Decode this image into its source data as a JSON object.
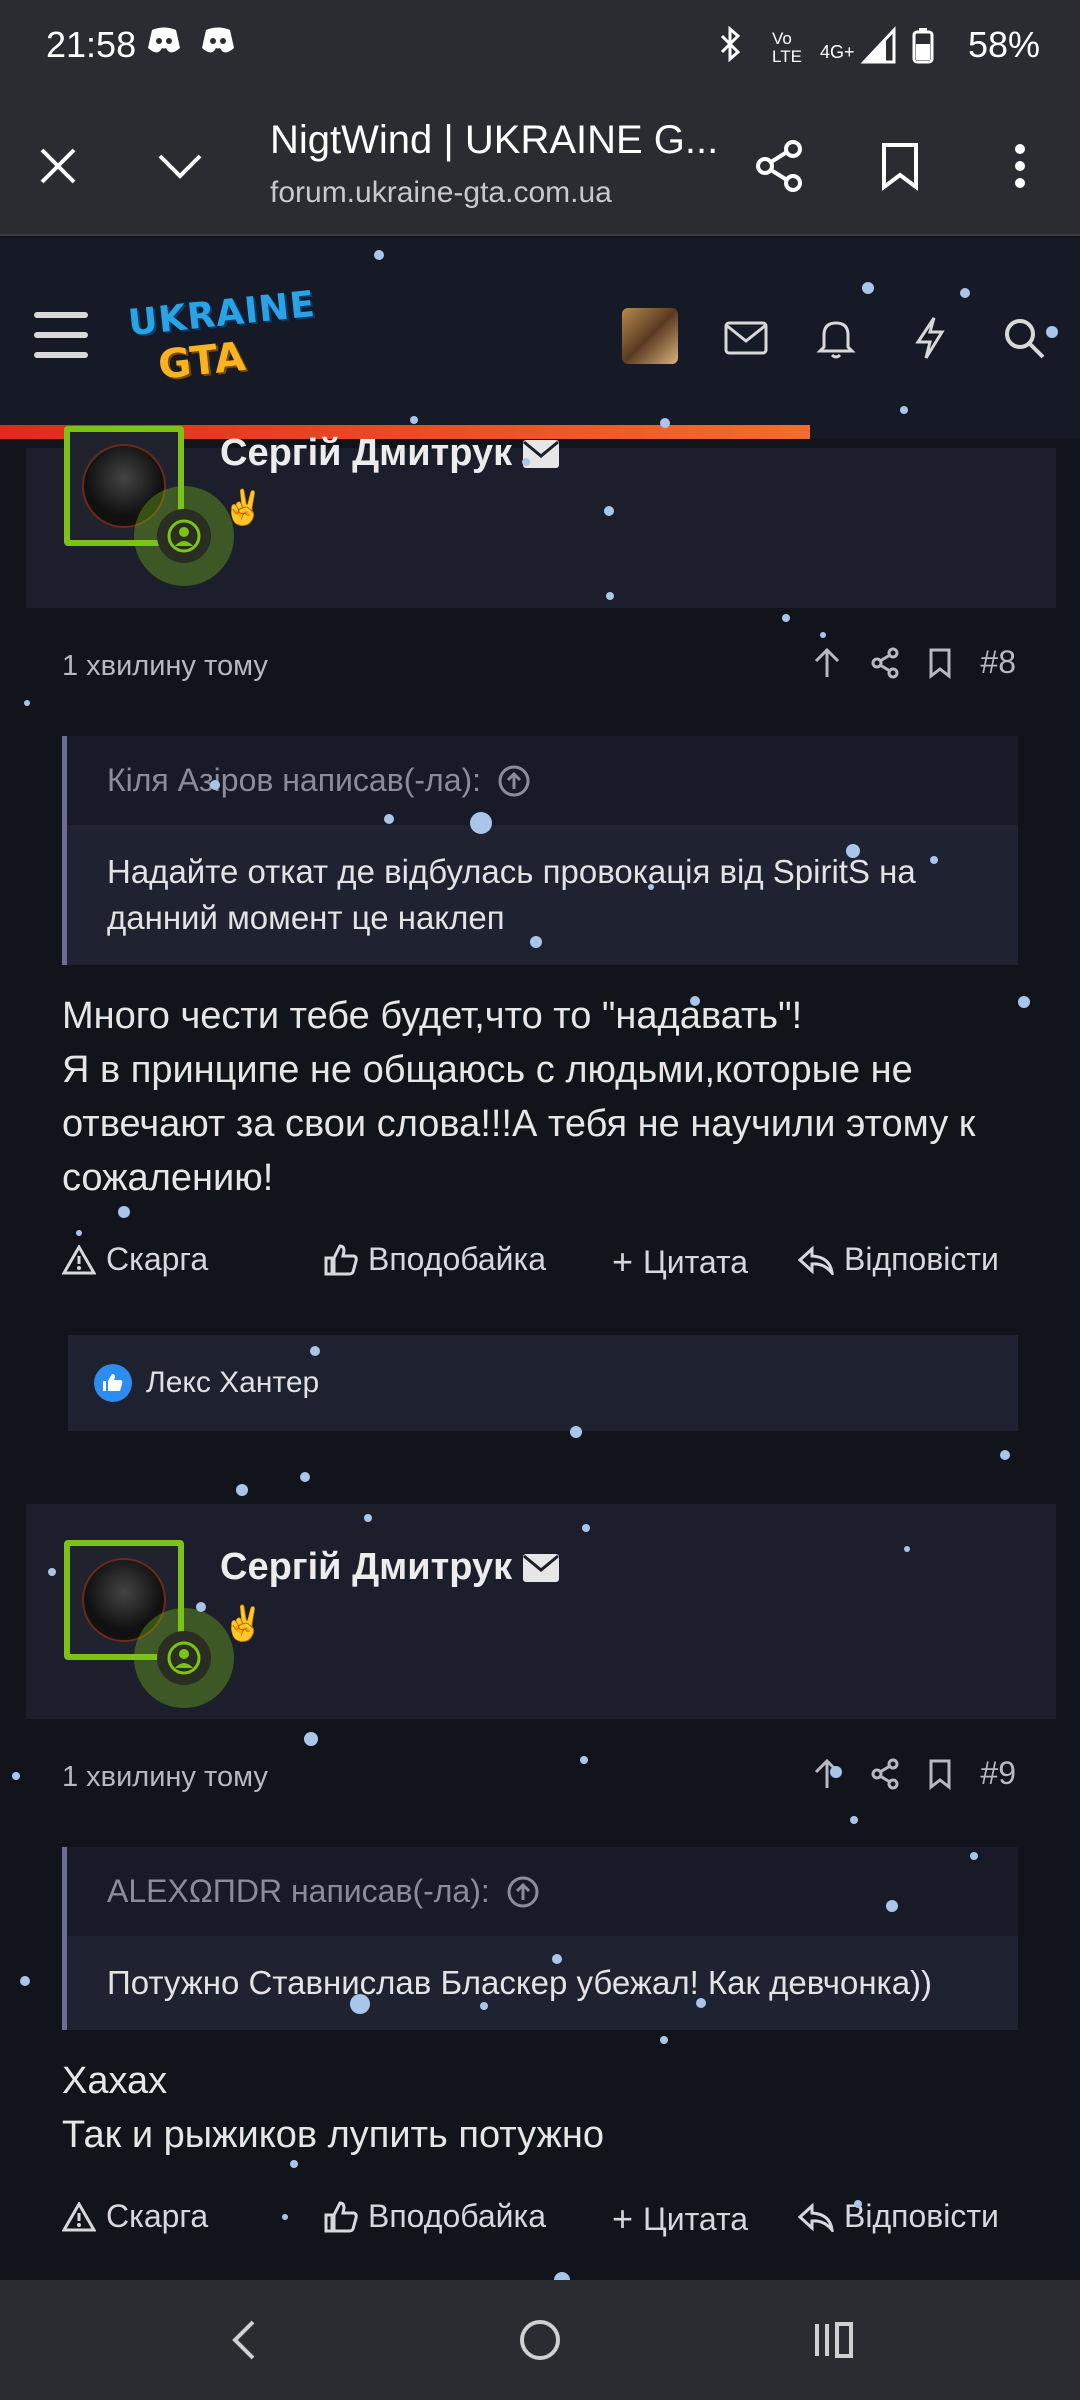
{
  "status_bar": {
    "time": "21:58",
    "battery": "58%",
    "icons": [
      "discord-icon",
      "discord-icon",
      "bluetooth-icon",
      "volte-icon",
      "4g-signal-icon",
      "battery-icon"
    ],
    "volte_text": "Vo LTE",
    "net_text": "4G+"
  },
  "browser": {
    "title": "NigtWind | UKRAINE G...",
    "url": "forum.ukraine-gta.com.ua"
  },
  "site": {
    "logo_line1": "UKRAINE",
    "logo_line2": "GTA",
    "header_icons": [
      "menu-icon",
      "avatar",
      "mail-icon",
      "bell-icon",
      "bolt-icon",
      "search-icon"
    ],
    "accent_color": "#7cc316",
    "progress_color": "#e02a1d"
  },
  "posts": [
    {
      "author": "Сергій Дмитрук",
      "emoji": "✌️",
      "time": "1 хвилину тому",
      "number": "#8",
      "quote_author": "Кіля Азіров написав(-ла):",
      "quote_text": "Надайте откат де відбулась провокація від SpiritS на данний момент це наклеп",
      "content_lines": [
        "Много чести тебе будет,что то \"надавать\"!",
        "Я в принципе не общаюсь с людьми,которые не",
        "отвечают за свои слова!!!А тебя не научили этому к",
        "сожалению!"
      ],
      "reaction_user": "Лекс Хантер"
    },
    {
      "author": "Сергій Дмитрук",
      "emoji": "✌️",
      "time": "1 хвилину тому",
      "number": "#9",
      "quote_author": "ALEXΩΠDR написав(-ла):",
      "quote_text": "Потужно Ставнислав Бласкер убежал! Как девчонка))",
      "content_lines": [
        "Хахах",
        "Так и рыжиков лупить потужно"
      ]
    }
  ],
  "actions": {
    "report": "Скарга",
    "like": "Вподобайка",
    "quote": "Цитата",
    "reply": "Відповісти"
  },
  "nav": [
    "back-icon",
    "home-icon",
    "recents-icon"
  ]
}
